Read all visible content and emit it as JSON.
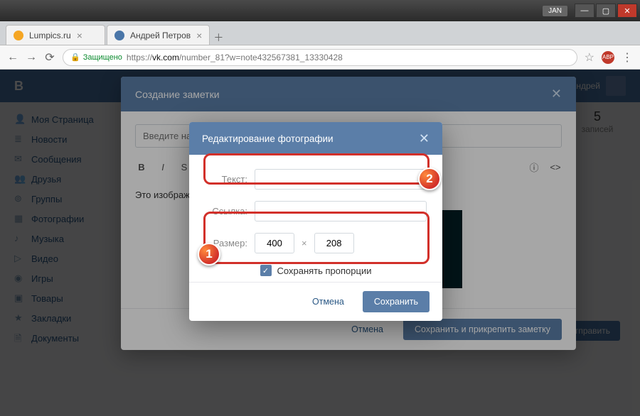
{
  "window": {
    "user_tag": "JAN"
  },
  "tabs": [
    {
      "title": "Lumpics.ru",
      "favicon_color": "#f5a623"
    },
    {
      "title": "Андрей Петров",
      "favicon_color": "#4a76a8"
    }
  ],
  "address_bar": {
    "secure_label": "Защищено",
    "url_prefix": "https://",
    "url_host": "vk.com",
    "url_path": "/number_81?w=note432567381_13330428"
  },
  "vk": {
    "user_name": "Андрей",
    "sidebar": {
      "items": [
        "Моя Страница",
        "Новости",
        "Сообщения",
        "Друзья",
        "Группы",
        "Фотографии",
        "Музыка",
        "Видео",
        "Игры",
        "Товары",
        "Закладки",
        "Документы"
      ]
    },
    "right_count": "5",
    "right_label": "записей",
    "send_label": "Отправить"
  },
  "note_modal": {
    "title": "Создание заметки",
    "title_placeholder": "Введите название заметки",
    "content_text": "Это изображение",
    "cancel": "Отмена",
    "save": "Сохранить и прикрепить заметку"
  },
  "photo_dialog": {
    "title": "Редактирование фотографии",
    "label_text": "Текст:",
    "label_link": "Ссылка:",
    "label_size": "Размер:",
    "width": "400",
    "height": "208",
    "keep_ratio": "Сохранять пропорции",
    "cancel": "Отмена",
    "save": "Сохранить"
  },
  "callouts": {
    "one": "1",
    "two": "2"
  }
}
